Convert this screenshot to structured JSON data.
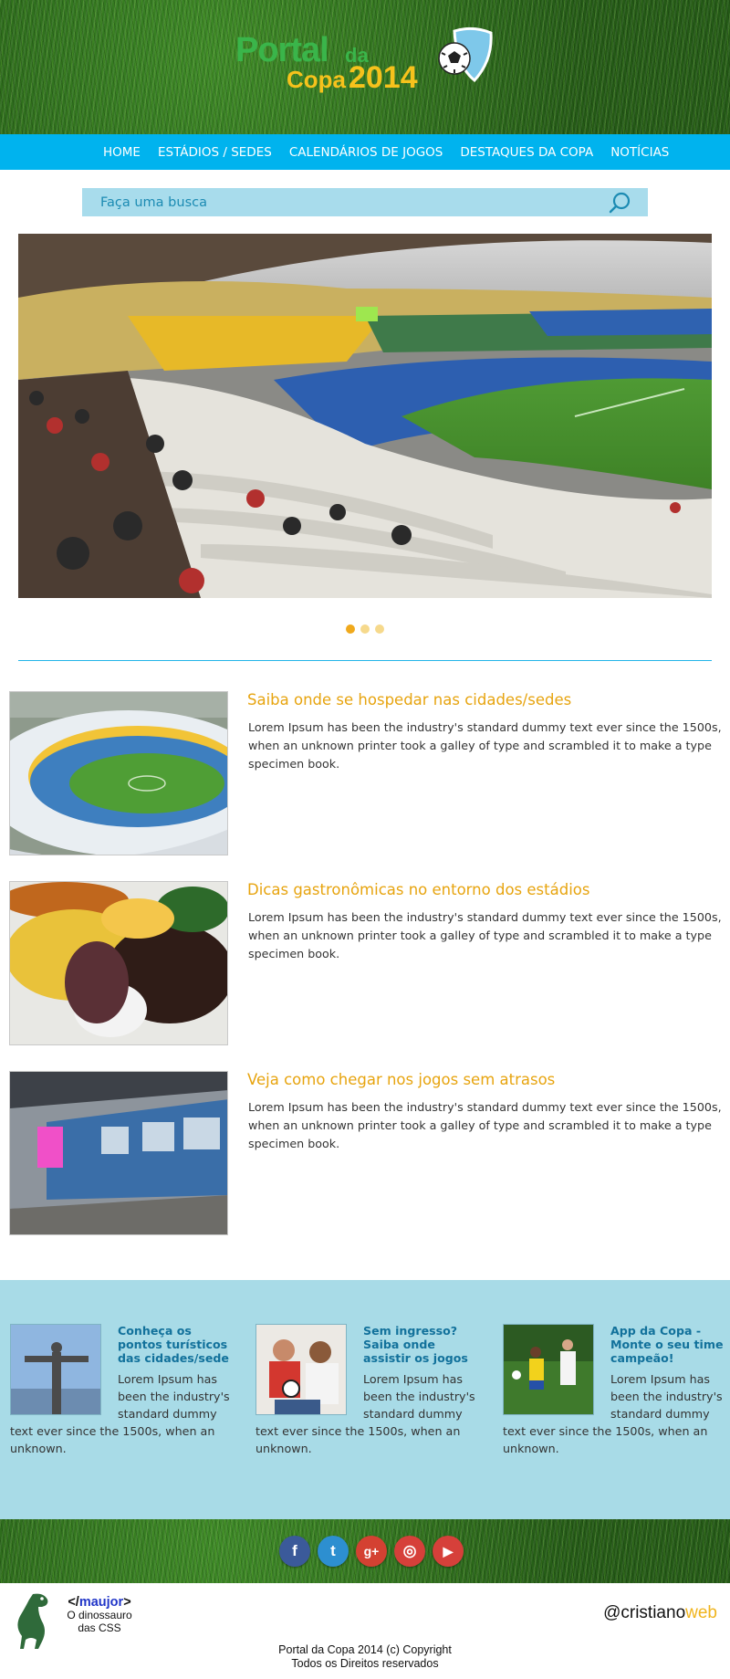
{
  "header": {
    "logo_line1": "Portal",
    "logo_line1_small": "da",
    "logo_line2": "Copa",
    "logo_year": "2014"
  },
  "nav": {
    "items": [
      {
        "label": "HOME"
      },
      {
        "label": "ESTÁDIOS / SEDES"
      },
      {
        "label": "CALENDÁRIOS DE JOGOS"
      },
      {
        "label": "DESTAQUES DA COPA"
      },
      {
        "label": "NOTÍCIAS"
      }
    ]
  },
  "search": {
    "placeholder": "Faça uma busca",
    "icon": "search-icon"
  },
  "slider": {
    "dots": [
      {
        "active": true
      },
      {
        "active": false
      },
      {
        "active": false
      }
    ]
  },
  "articles": [
    {
      "title": "Saiba onde se hospedar nas cidades/sedes",
      "text": "Lorem Ipsum has been the industry's standard dummy text ever since the 1500s, when an unknown printer took a galley of type and scrambled it to make a type specimen book."
    },
    {
      "title": "Dicas gastronômicas no entorno dos estádios",
      "text": "Lorem Ipsum has been the industry's standard dummy text ever since the 1500s, when an unknown printer took a galley of type and scrambled it to make a type specimen book."
    },
    {
      "title": "Veja como chegar nos jogos sem atrasos",
      "text": "Lorem Ipsum has been the industry's standard dummy text ever since the 1500s, when an unknown printer took a galley of type and scrambled it to make a type specimen book."
    }
  ],
  "promo": [
    {
      "title": "Conheça os pontos turísticos das cidades/sede",
      "text": "Lorem Ipsum has been the industry's standard dummy text ever since the 1500s, when an unknown."
    },
    {
      "title": "Sem ingresso? Saiba onde assistir os jogos",
      "text": "Lorem Ipsum has been the industry's standard dummy text ever since the 1500s, when an unknown."
    },
    {
      "title": "App da Copa - Monte o seu time campeão!",
      "text": "Lorem Ipsum has been the industry's standard dummy text ever since the 1500s, when an unknown."
    }
  ],
  "social": {
    "icons": [
      {
        "name": "facebook-icon",
        "glyph": "f",
        "color": "#3b5a9a"
      },
      {
        "name": "twitter-icon",
        "glyph": "t",
        "color": "#2d8fd0"
      },
      {
        "name": "google-plus-icon",
        "glyph": "g+",
        "color": "#d44132"
      },
      {
        "name": "instagram-icon",
        "glyph": "◎",
        "color": "#d6403a"
      },
      {
        "name": "youtube-icon",
        "glyph": "▶",
        "color": "#d6403a"
      }
    ]
  },
  "footer": {
    "maujor_open": "</",
    "maujor_name": "maujor",
    "maujor_close": ">",
    "maujor_line1": "O dinossauro",
    "maujor_line2": "das CSS",
    "cristiano_main": "@cristiano",
    "cristiano_accent": "web",
    "copyright_line1": "Portal da Copa 2014 (c) Copyright",
    "copyright_line2": "Todos os Direitos reservados"
  },
  "colors": {
    "nav": "#00b3ee",
    "accent": "#e7a40f",
    "promo_bg": "#a8dbe7",
    "search_bg": "#a8dcec",
    "dot_active": "#f0a91c",
    "dot_inactive": "#f6d98c"
  }
}
